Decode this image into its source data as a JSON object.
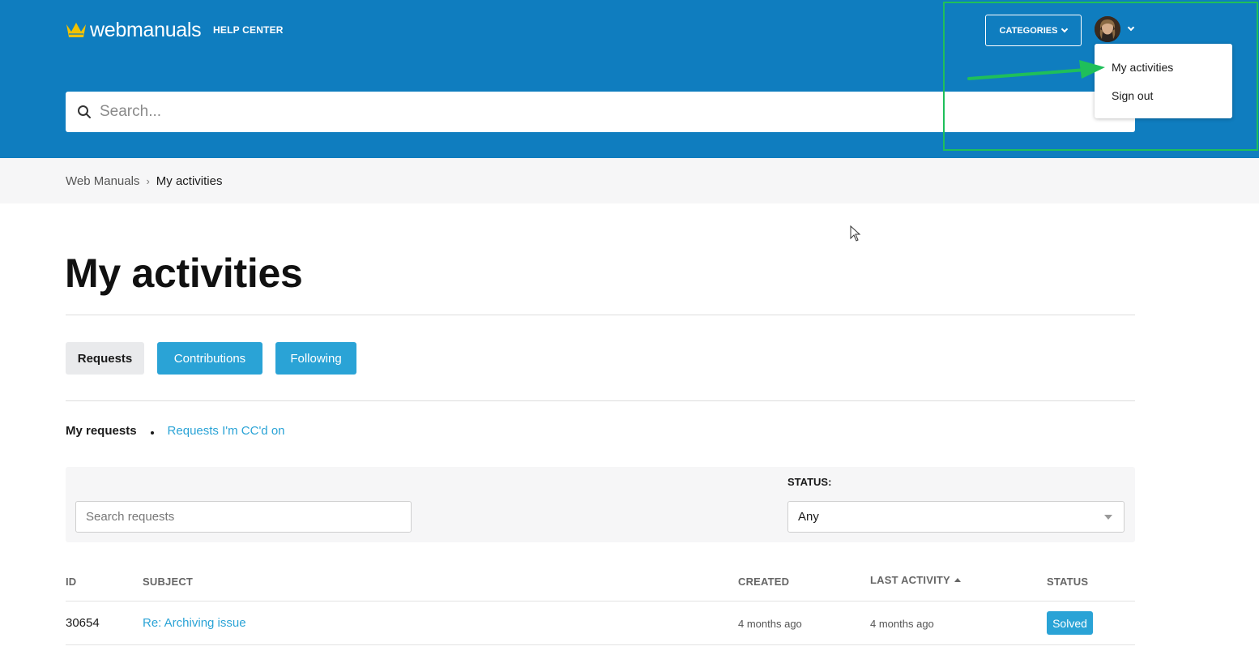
{
  "header": {
    "logo_text": "webmanuals",
    "help_center": "HELP CENTER",
    "categories_label": "CATEGORIES",
    "search_placeholder": "Search...",
    "brand_color": "#0f7dbf",
    "logo_color": "#f2c200"
  },
  "user_menu": {
    "items": [
      {
        "label": "My activities"
      },
      {
        "label": "Sign out"
      }
    ]
  },
  "breadcrumb": {
    "items": [
      "Web Manuals",
      "My activities"
    ]
  },
  "page": {
    "title": "My activities",
    "tabs": [
      {
        "label": "Requests",
        "active": true
      },
      {
        "label": "Contributions",
        "active": false
      },
      {
        "label": "Following",
        "active": false
      }
    ],
    "subnav": {
      "current": "My requests",
      "link": "Requests I'm CC'd on"
    }
  },
  "filters": {
    "search_placeholder": "Search requests",
    "status_label": "STATUS:",
    "status_value": "Any"
  },
  "table": {
    "headers": {
      "id": "ID",
      "subject": "SUBJECT",
      "created": "CREATED",
      "last_activity": "LAST ACTIVITY",
      "status": "STATUS"
    },
    "rows": [
      {
        "id": "30654",
        "subject": "Re: Archiving issue",
        "created": "4 months ago",
        "last_activity": "4 months ago",
        "status": "Solved"
      }
    ]
  },
  "accent_color": "#2aa3d6",
  "annotation_color": "#1fbf5a"
}
